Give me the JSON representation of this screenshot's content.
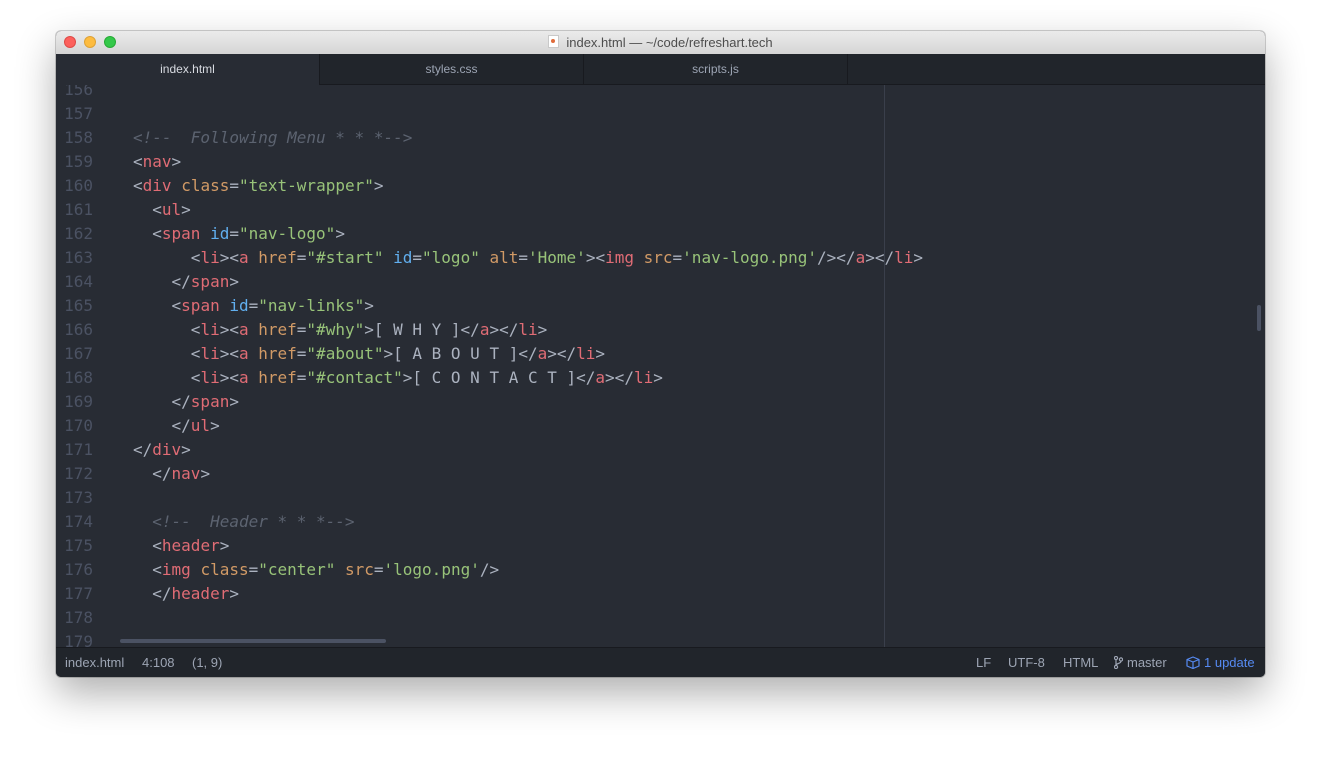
{
  "window": {
    "title": "index.html — ~/code/refreshart.tech"
  },
  "tabs": [
    {
      "label": "index.html",
      "active": true
    },
    {
      "label": "styles.css",
      "active": false
    },
    {
      "label": "scripts.js",
      "active": false
    }
  ],
  "editor": {
    "lines": [
      {
        "num": "156",
        "tokens": []
      },
      {
        "num": "157",
        "tokens": []
      },
      {
        "num": "158",
        "tokens": [
          {
            "t": "<!--  Following Menu * * *-->",
            "c": "cmt"
          }
        ]
      },
      {
        "num": "159",
        "tokens": [
          {
            "t": "<",
            "c": "txt"
          },
          {
            "t": "nav",
            "c": "tag"
          },
          {
            "t": ">",
            "c": "txt"
          }
        ]
      },
      {
        "num": "160",
        "tokens": [
          {
            "t": "<",
            "c": "txt"
          },
          {
            "t": "div",
            "c": "tag"
          },
          {
            "t": " ",
            "c": "txt"
          },
          {
            "t": "class",
            "c": "attr"
          },
          {
            "t": "=",
            "c": "txt"
          },
          {
            "t": "\"text-wrapper\"",
            "c": "str"
          },
          {
            "t": ">",
            "c": "txt"
          }
        ]
      },
      {
        "num": "161",
        "tokens": [
          {
            "t": "  <",
            "c": "txt"
          },
          {
            "t": "ul",
            "c": "tag"
          },
          {
            "t": ">",
            "c": "txt"
          }
        ]
      },
      {
        "num": "162",
        "tokens": [
          {
            "t": "  <",
            "c": "txt"
          },
          {
            "t": "span",
            "c": "tag"
          },
          {
            "t": " ",
            "c": "txt"
          },
          {
            "t": "id",
            "c": "id"
          },
          {
            "t": "=",
            "c": "txt"
          },
          {
            "t": "\"nav-logo\"",
            "c": "str"
          },
          {
            "t": ">",
            "c": "txt"
          }
        ]
      },
      {
        "num": "163",
        "tokens": [
          {
            "t": "      <",
            "c": "txt"
          },
          {
            "t": "li",
            "c": "tag"
          },
          {
            "t": "><",
            "c": "txt"
          },
          {
            "t": "a",
            "c": "tag"
          },
          {
            "t": " ",
            "c": "txt"
          },
          {
            "t": "href",
            "c": "attr"
          },
          {
            "t": "=",
            "c": "txt"
          },
          {
            "t": "\"#start\"",
            "c": "str"
          },
          {
            "t": " ",
            "c": "txt"
          },
          {
            "t": "id",
            "c": "id"
          },
          {
            "t": "=",
            "c": "txt"
          },
          {
            "t": "\"logo\"",
            "c": "str"
          },
          {
            "t": " ",
            "c": "txt"
          },
          {
            "t": "alt",
            "c": "attr"
          },
          {
            "t": "=",
            "c": "txt"
          },
          {
            "t": "'Home'",
            "c": "str"
          },
          {
            "t": "><",
            "c": "txt"
          },
          {
            "t": "img",
            "c": "tag"
          },
          {
            "t": " ",
            "c": "txt"
          },
          {
            "t": "src",
            "c": "attr"
          },
          {
            "t": "=",
            "c": "txt"
          },
          {
            "t": "'nav-logo.png'",
            "c": "str"
          },
          {
            "t": "/></",
            "c": "txt"
          },
          {
            "t": "a",
            "c": "tag"
          },
          {
            "t": "></",
            "c": "txt"
          },
          {
            "t": "li",
            "c": "tag"
          },
          {
            "t": ">",
            "c": "txt"
          }
        ]
      },
      {
        "num": "164",
        "tokens": [
          {
            "t": "    </",
            "c": "txt"
          },
          {
            "t": "span",
            "c": "tag"
          },
          {
            "t": ">",
            "c": "txt"
          }
        ]
      },
      {
        "num": "165",
        "tokens": [
          {
            "t": "    <",
            "c": "txt"
          },
          {
            "t": "span",
            "c": "tag"
          },
          {
            "t": " ",
            "c": "txt"
          },
          {
            "t": "id",
            "c": "id"
          },
          {
            "t": "=",
            "c": "txt"
          },
          {
            "t": "\"nav-links\"",
            "c": "str"
          },
          {
            "t": ">",
            "c": "txt"
          }
        ]
      },
      {
        "num": "166",
        "tokens": [
          {
            "t": "      <",
            "c": "txt"
          },
          {
            "t": "li",
            "c": "tag"
          },
          {
            "t": "><",
            "c": "txt"
          },
          {
            "t": "a",
            "c": "tag"
          },
          {
            "t": " ",
            "c": "txt"
          },
          {
            "t": "href",
            "c": "attr"
          },
          {
            "t": "=",
            "c": "txt"
          },
          {
            "t": "\"#why\"",
            "c": "str"
          },
          {
            "t": ">[ W H Y ]</",
            "c": "txt"
          },
          {
            "t": "a",
            "c": "tag"
          },
          {
            "t": "></",
            "c": "txt"
          },
          {
            "t": "li",
            "c": "tag"
          },
          {
            "t": ">",
            "c": "txt"
          }
        ]
      },
      {
        "num": "167",
        "tokens": [
          {
            "t": "      <",
            "c": "txt"
          },
          {
            "t": "li",
            "c": "tag"
          },
          {
            "t": "><",
            "c": "txt"
          },
          {
            "t": "a",
            "c": "tag"
          },
          {
            "t": " ",
            "c": "txt"
          },
          {
            "t": "href",
            "c": "attr"
          },
          {
            "t": "=",
            "c": "txt"
          },
          {
            "t": "\"#about\"",
            "c": "str"
          },
          {
            "t": ">[ A B O U T ]</",
            "c": "txt"
          },
          {
            "t": "a",
            "c": "tag"
          },
          {
            "t": "></",
            "c": "txt"
          },
          {
            "t": "li",
            "c": "tag"
          },
          {
            "t": ">",
            "c": "txt"
          }
        ]
      },
      {
        "num": "168",
        "tokens": [
          {
            "t": "      <",
            "c": "txt"
          },
          {
            "t": "li",
            "c": "tag"
          },
          {
            "t": "><",
            "c": "txt"
          },
          {
            "t": "a",
            "c": "tag"
          },
          {
            "t": " ",
            "c": "txt"
          },
          {
            "t": "href",
            "c": "attr"
          },
          {
            "t": "=",
            "c": "txt"
          },
          {
            "t": "\"#contact\"",
            "c": "str"
          },
          {
            "t": ">[ C O N T A C T ]</",
            "c": "txt"
          },
          {
            "t": "a",
            "c": "tag"
          },
          {
            "t": "></",
            "c": "txt"
          },
          {
            "t": "li",
            "c": "tag"
          },
          {
            "t": ">",
            "c": "txt"
          }
        ]
      },
      {
        "num": "169",
        "tokens": [
          {
            "t": "    </",
            "c": "txt"
          },
          {
            "t": "span",
            "c": "tag"
          },
          {
            "t": ">",
            "c": "txt"
          }
        ]
      },
      {
        "num": "170",
        "tokens": [
          {
            "t": "    </",
            "c": "txt"
          },
          {
            "t": "ul",
            "c": "tag"
          },
          {
            "t": ">",
            "c": "txt"
          }
        ]
      },
      {
        "num": "171",
        "tokens": [
          {
            "t": "</",
            "c": "txt"
          },
          {
            "t": "div",
            "c": "tag"
          },
          {
            "t": ">",
            "c": "txt"
          }
        ]
      },
      {
        "num": "172",
        "tokens": [
          {
            "t": "  </",
            "c": "txt"
          },
          {
            "t": "nav",
            "c": "tag"
          },
          {
            "t": ">",
            "c": "txt"
          }
        ]
      },
      {
        "num": "173",
        "tokens": []
      },
      {
        "num": "174",
        "tokens": [
          {
            "t": "  <!--  Header * * *-->",
            "c": "cmt"
          }
        ]
      },
      {
        "num": "175",
        "tokens": [
          {
            "t": "  <",
            "c": "txt"
          },
          {
            "t": "header",
            "c": "tag"
          },
          {
            "t": ">",
            "c": "txt"
          }
        ]
      },
      {
        "num": "176",
        "tokens": [
          {
            "t": "  <",
            "c": "txt"
          },
          {
            "t": "img",
            "c": "tag"
          },
          {
            "t": " ",
            "c": "txt"
          },
          {
            "t": "class",
            "c": "attr"
          },
          {
            "t": "=",
            "c": "txt"
          },
          {
            "t": "\"center\"",
            "c": "str"
          },
          {
            "t": " ",
            "c": "txt"
          },
          {
            "t": "src",
            "c": "attr"
          },
          {
            "t": "=",
            "c": "txt"
          },
          {
            "t": "'logo.png'",
            "c": "str"
          },
          {
            "t": "/>",
            "c": "txt"
          }
        ]
      },
      {
        "num": "177",
        "tokens": [
          {
            "t": "  </",
            "c": "txt"
          },
          {
            "t": "header",
            "c": "tag"
          },
          {
            "t": ">",
            "c": "txt"
          }
        ]
      },
      {
        "num": "178",
        "tokens": []
      },
      {
        "num": "179",
        "tokens": []
      }
    ]
  },
  "status": {
    "file": "index.html",
    "cursor": "4:108",
    "selection": "(1, 9)",
    "line_ending": "LF",
    "encoding": "UTF-8",
    "grammar": "HTML",
    "branch": "master",
    "updates": "1 update"
  },
  "icons": {
    "close": "close-button-icon",
    "minimize": "minimize-button-icon",
    "zoom": "zoom-button-icon",
    "branch": "git-branch-icon",
    "updates": "package-icon"
  },
  "colors": {
    "tag": "#e06c75",
    "attribute": "#d19a66",
    "id_attribute": "#61afef",
    "string": "#98c379",
    "comment": "#5c6370",
    "text": "#abb2bf",
    "update_link": "#568af2"
  }
}
